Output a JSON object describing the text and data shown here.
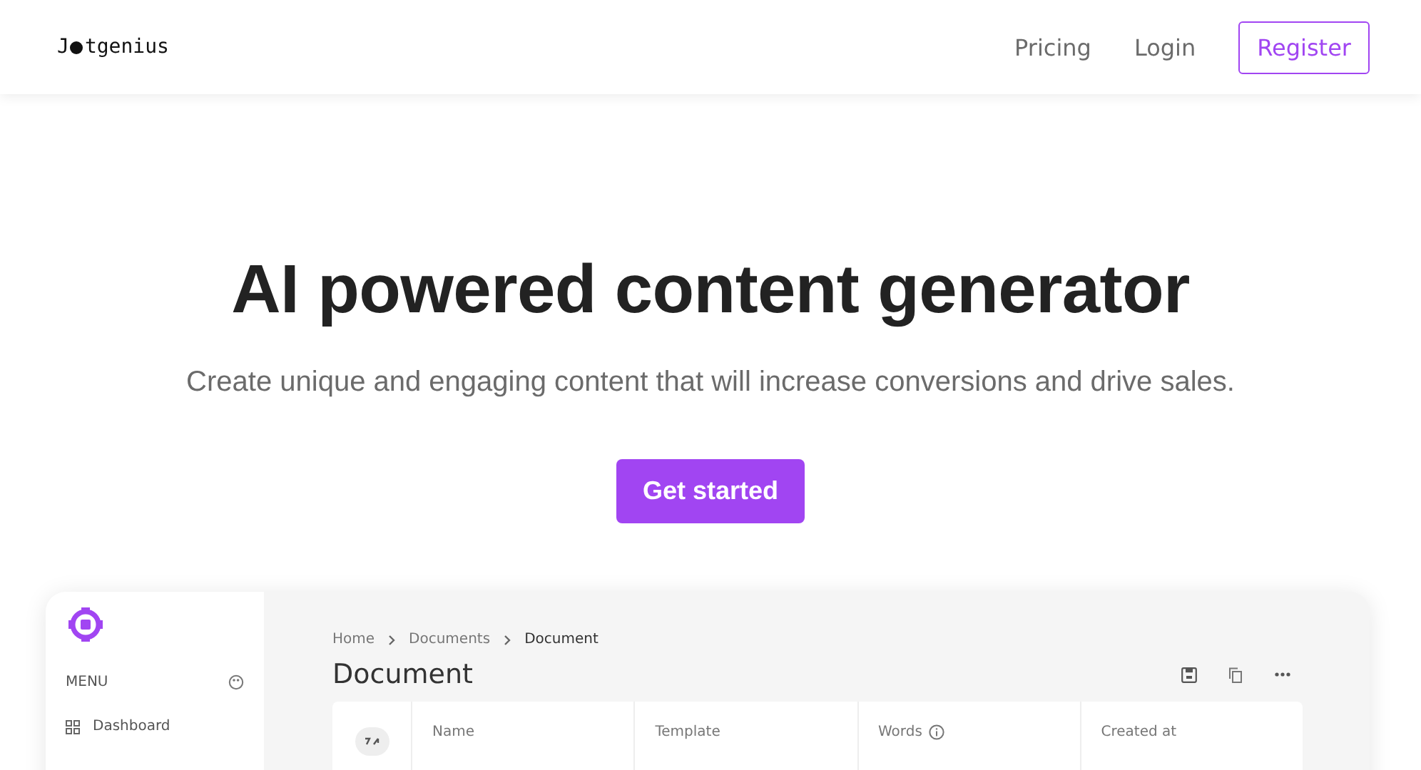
{
  "header": {
    "logo": {
      "before": "J",
      "after": "tgenius"
    },
    "nav": [
      {
        "label": "Pricing",
        "kind": "link"
      },
      {
        "label": "Login",
        "kind": "link"
      },
      {
        "label": "Register",
        "kind": "outline"
      }
    ]
  },
  "hero": {
    "title": "AI powered content generator",
    "subtitle": "Create unique and engaging content that will increase conversions and drive sales.",
    "cta": "Get started"
  },
  "preview": {
    "sidebar": {
      "menu_label": "MENU",
      "items": [
        "Dashboard"
      ]
    },
    "breadcrumb": [
      "Home",
      "Documents",
      "Document"
    ],
    "title": "Document",
    "table": {
      "columns": [
        {
          "label": "Name",
          "info": false
        },
        {
          "label": "Template",
          "info": false
        },
        {
          "label": "Words",
          "info": true
        },
        {
          "label": "Created at",
          "info": false
        }
      ]
    }
  }
}
